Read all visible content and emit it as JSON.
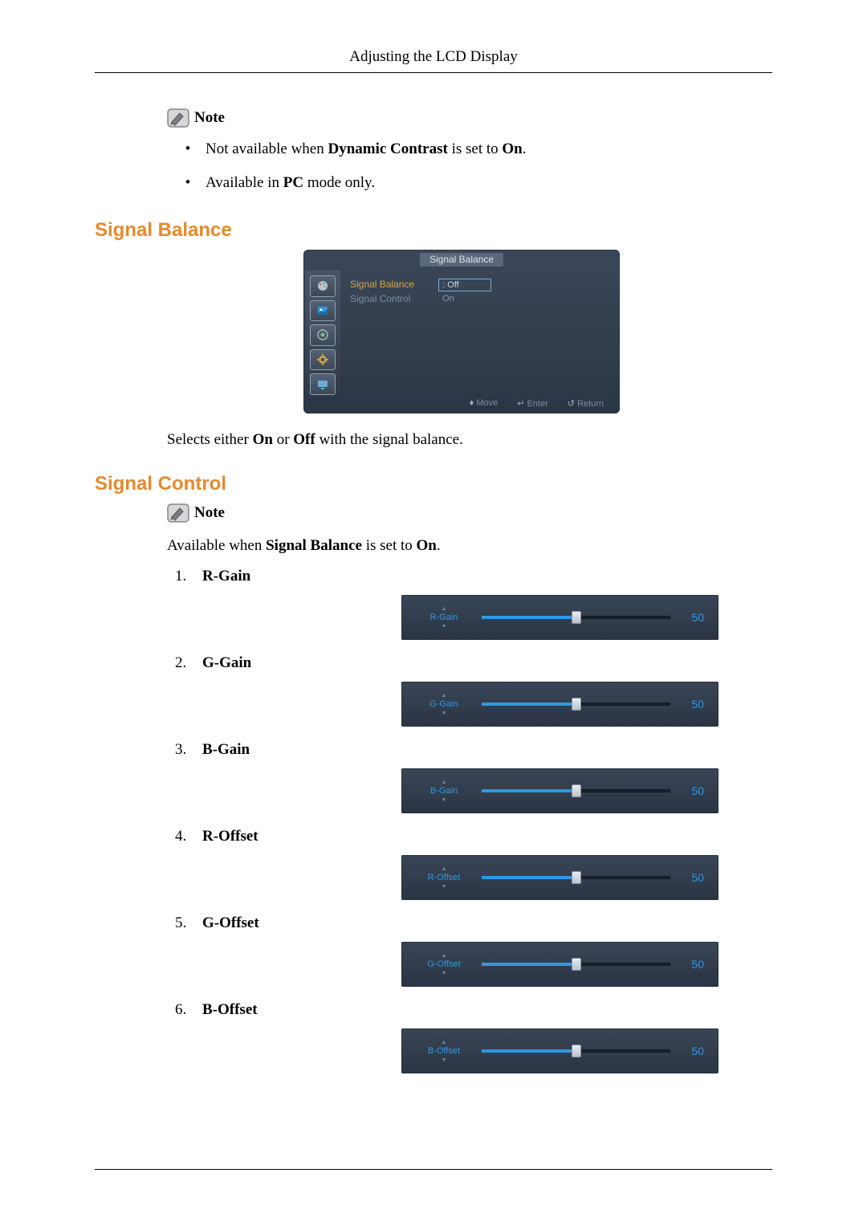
{
  "header": {
    "title": "Adjusting the LCD Display"
  },
  "note_label": "Note",
  "bullets": {
    "b1_pre": "Not available when ",
    "b1_bold": "Dynamic Contrast",
    "b1_mid": " is set to ",
    "b1_bold2": "On",
    "b1_post": ".",
    "b2_pre": "Available in ",
    "b2_bold": "PC",
    "b2_post": " mode only."
  },
  "section1": {
    "heading": "Signal Balance"
  },
  "osd": {
    "title": "Signal Balance",
    "items": {
      "sigbal": "Signal Balance",
      "sigctl": "Signal Control"
    },
    "options": {
      "off": "Off",
      "on": "On"
    },
    "footer": {
      "move": "Move",
      "enter": "Enter",
      "return": "Return"
    }
  },
  "sigbal_desc": {
    "pre": "Selects either ",
    "b1": "On",
    "mid": " or ",
    "b2": "Off",
    "post": " with the signal balance."
  },
  "section2": {
    "heading": "Signal Control"
  },
  "sigctl_desc": {
    "pre": "Available when ",
    "b1": "Signal Balance",
    "mid": " is set to ",
    "b2": "On",
    "post": "."
  },
  "controls": [
    {
      "num": "1.",
      "label": "R-Gain",
      "slider_label": "R-Gain",
      "value": "50"
    },
    {
      "num": "2.",
      "label": "G-Gain",
      "slider_label": "G-Gain",
      "value": "50"
    },
    {
      "num": "3.",
      "label": "B-Gain",
      "slider_label": "B-Gain",
      "value": "50"
    },
    {
      "num": "4.",
      "label": "R-Offset",
      "slider_label": "R-Offset",
      "value": "50"
    },
    {
      "num": "5.",
      "label": "G-Offset",
      "slider_label": "G-Offset",
      "value": "50"
    },
    {
      "num": "6.",
      "label": "B-Offset",
      "slider_label": "B-Offset",
      "value": "50"
    }
  ]
}
